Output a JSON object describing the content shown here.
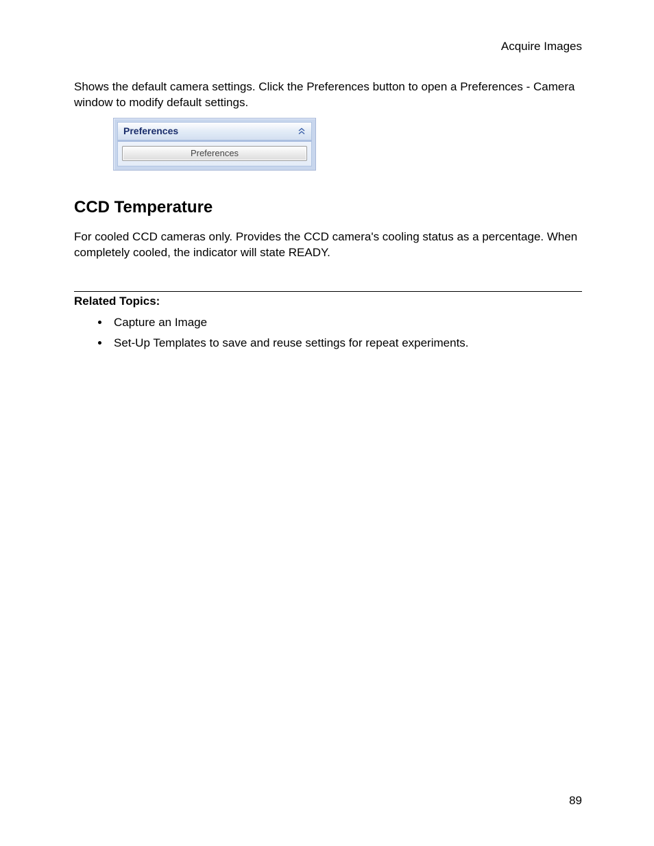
{
  "header": {
    "section": "Acquire Images"
  },
  "intro": {
    "text": "Shows the default camera settings. Click the Preferences button to open a Preferences - Camera window to modify default settings."
  },
  "panel": {
    "title": "Preferences",
    "collapse_icon": "chevron-double-up-icon",
    "button_label": "Preferences"
  },
  "section": {
    "heading": "CCD Temperature",
    "body": "For cooled CCD cameras only. Provides the CCD camera's cooling status as a percentage. When completely cooled, the indicator will state READY."
  },
  "related": {
    "heading": "Related Topics:",
    "items": [
      "Capture an Image",
      "Set-Up Templates to save and reuse settings for repeat experiments."
    ]
  },
  "page_number": "89"
}
